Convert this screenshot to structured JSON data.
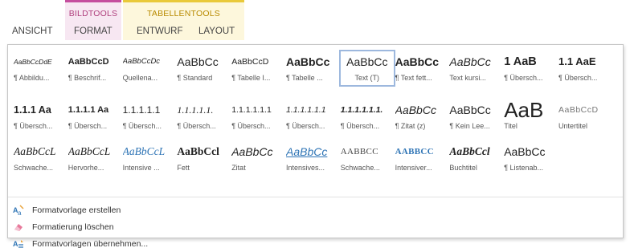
{
  "ribbon": {
    "contextual": [
      {
        "label": "BILDTOOLS"
      },
      {
        "label": "TABELLENTOOLS"
      }
    ],
    "tabs": [
      {
        "label": "ANSICHT"
      },
      {
        "label": "FORMAT"
      },
      {
        "label": "ENTWURF"
      },
      {
        "label": "LAYOUT"
      }
    ]
  },
  "gallery": {
    "rows": [
      [
        {
          "preview": "AaBbCcDdE",
          "name": "¶ Abbildu..."
        },
        {
          "preview": "AaBbCcD",
          "name": "¶ Beschrif..."
        },
        {
          "preview": "AaBbCcDc",
          "name": "Quellena..."
        },
        {
          "preview": "AaBbCc",
          "name": "¶ Standard"
        },
        {
          "preview": "AaBbCcD",
          "name": "¶ Tabelle I..."
        },
        {
          "preview": "AaBbCc",
          "name": "¶ Tabelle ..."
        },
        {
          "preview": "AaBbCc",
          "name": "Text (T)"
        },
        {
          "preview": "AaBbCc",
          "name": "¶ Text fett..."
        },
        {
          "preview": "AaBbCc",
          "name": "Text kursi..."
        },
        {
          "preview": "1 AaB",
          "name": "¶ Übersch..."
        },
        {
          "preview": "1.1 AaE",
          "name": "¶ Übersch..."
        }
      ],
      [
        {
          "preview": "1.1.1 Aa",
          "name": "¶ Übersch..."
        },
        {
          "preview": "1.1.1.1 Aa",
          "name": "¶ Übersch..."
        },
        {
          "preview": "1.1.1.1.1",
          "name": "¶ Übersch..."
        },
        {
          "preview": "1.1.1.1.1.",
          "name": "¶ Übersch..."
        },
        {
          "preview": "1.1.1.1.1.1",
          "name": "¶ Übersch..."
        },
        {
          "preview": "1.1.1.1.1.1",
          "name": "¶ Übersch..."
        },
        {
          "preview": "1.1.1.1.1.1.",
          "name": "¶ Übersch..."
        },
        {
          "preview": "AaBbCc",
          "name": "¶ Zitat (z)"
        },
        {
          "preview": "AaBbCc",
          "name": "¶ Kein Lee..."
        },
        {
          "preview": "AaB",
          "name": "Titel"
        },
        {
          "preview": "AaBbCcD",
          "name": "Untertitel"
        }
      ],
      [
        {
          "preview": "AaBbCcL",
          "name": "Schwache..."
        },
        {
          "preview": "AaBbCcL",
          "name": "Hervorhe..."
        },
        {
          "preview": "AaBbCcL",
          "name": "Intensive ..."
        },
        {
          "preview": "AaBbCcl",
          "name": "Fett"
        },
        {
          "preview": "AaBbCc",
          "name": "Zitat"
        },
        {
          "preview": "AaBbCc",
          "name": "Intensives..."
        },
        {
          "preview": "AABBCC",
          "name": "Schwache..."
        },
        {
          "preview": "AABBCC",
          "name": "Intensiver..."
        },
        {
          "preview": "AaBbCcl",
          "name": "Buchtitel"
        },
        {
          "preview": "AaBbCc",
          "name": "¶ Listenab..."
        }
      ]
    ]
  },
  "commands": [
    {
      "label": "Formatvorlage erstellen",
      "icon": "create-style-icon"
    },
    {
      "label": "Formatierung löschen",
      "icon": "clear-formatting-icon"
    },
    {
      "label": "Formatvorlagen übernehmen...",
      "icon": "apply-styles-icon"
    }
  ],
  "colors": {
    "bildtools_accent": "#c54d9e",
    "tabellentools_accent": "#e9c93a",
    "heading_blue": "#2e74b5",
    "selection_border": "#9db8de"
  }
}
